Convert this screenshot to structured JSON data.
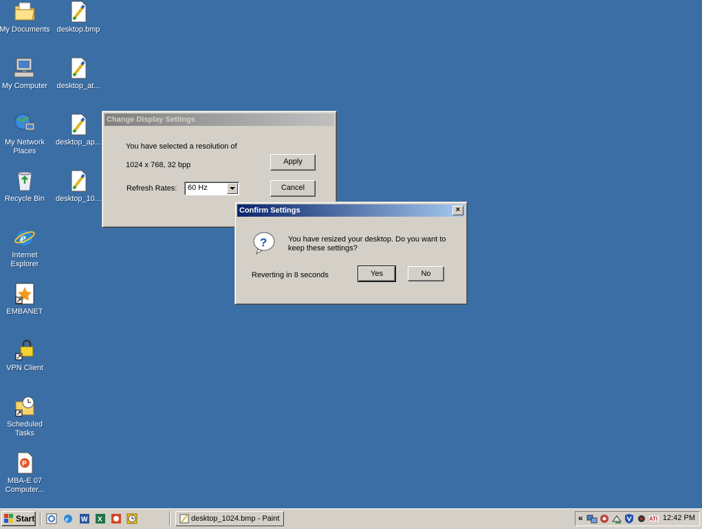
{
  "desktop": {
    "icons": [
      {
        "label": "My Documents"
      },
      {
        "label": "My Computer"
      },
      {
        "label": "My Network Places"
      },
      {
        "label": "Recycle Bin"
      },
      {
        "label": "Internet Explorer"
      },
      {
        "label": "EMBANET"
      },
      {
        "label": "VPN Client"
      },
      {
        "label": "Scheduled Tasks"
      },
      {
        "label": "MBA-E 07 Computer..."
      },
      {
        "label": "desktop.bmp"
      },
      {
        "label": "desktop_at..."
      },
      {
        "label": "desktop_ap..."
      },
      {
        "label": "desktop_10..."
      }
    ]
  },
  "display_dialog": {
    "title": "Change Display Settings",
    "line1": "You have selected a resolution of",
    "line2": "1024 x 768, 32 bpp",
    "refresh_label": "Refresh Rates:",
    "refresh_value": "60 Hz",
    "apply_label": "Apply",
    "cancel_label": "Cancel"
  },
  "confirm_dialog": {
    "title": "Confirm Settings",
    "close_glyph": "×",
    "message_line1": "You have resized your desktop.  Do you want to",
    "message_line2": "keep these settings?",
    "countdown": "Reverting in 8 seconds",
    "yes_label": "Yes",
    "no_label": "No"
  },
  "taskbar": {
    "start_label": "Start",
    "task_label": "desktop_1024.bmp - Paint",
    "tray_chevron": "«",
    "clock": "12:42 PM"
  },
  "colors": {
    "desktop": "#3a6ea5",
    "active_title": "#0a246a",
    "inactive_title": "#808080",
    "face": "#d4d0c8"
  }
}
